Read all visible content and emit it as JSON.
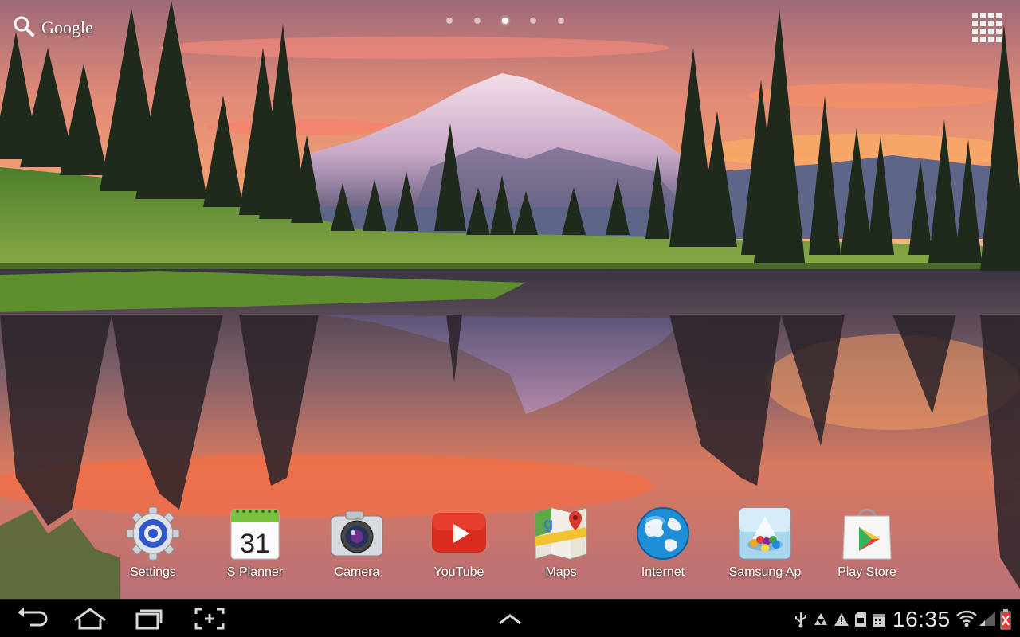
{
  "search": {
    "label": "Google",
    "icon": "search-icon"
  },
  "pager": {
    "count": 5,
    "active_index": 2
  },
  "apps_button": {
    "icon": "apps-grid-icon"
  },
  "dock": {
    "items": [
      {
        "label": "Settings",
        "icon": "settings-gear-icon"
      },
      {
        "label": "S Planner",
        "icon": "calendar-icon",
        "badge": "31"
      },
      {
        "label": "Camera",
        "icon": "camera-icon"
      },
      {
        "label": "YouTube",
        "icon": "youtube-icon"
      },
      {
        "label": "Maps",
        "icon": "maps-icon"
      },
      {
        "label": "Internet",
        "icon": "globe-icon"
      },
      {
        "label": "Samsung Ap",
        "icon": "samsung-apps-icon"
      },
      {
        "label": "Play Store",
        "icon": "play-store-icon"
      }
    ]
  },
  "navbar": {
    "back": "back-icon",
    "home": "home-icon",
    "recents": "recent-apps-icon",
    "screenshot": "screen-capture-icon",
    "expand": "chevron-up-icon"
  },
  "status": {
    "time": "16:35",
    "icons": [
      "usb-icon",
      "recycle-icon",
      "warning-icon",
      "sd-card-icon",
      "calendar-notification-icon",
      "wifi-icon",
      "signal-icon",
      "battery-icon"
    ],
    "battery_level": 0.15,
    "battery_color": "#e53935"
  },
  "colors": {
    "sky_top": "#c86a68",
    "sunset_orange": "#ff8a4c",
    "grass": "#5b8a2b"
  }
}
